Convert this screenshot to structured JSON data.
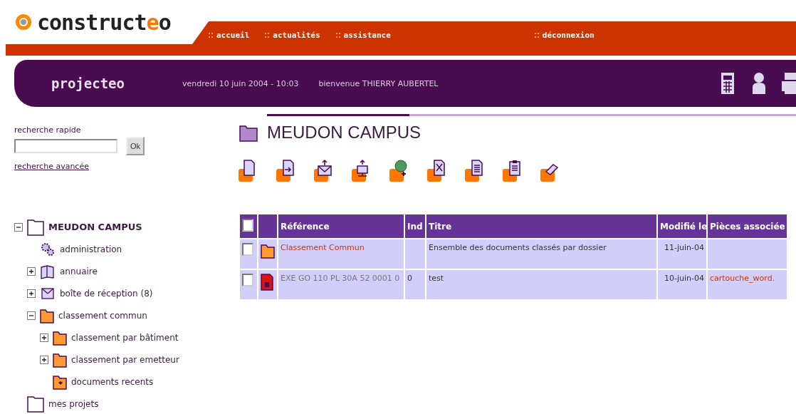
{
  "logo": [
    {
      "text": "construct",
      "accent": false
    },
    {
      "text": "e",
      "accent": true
    },
    {
      "text": "o",
      "accent": false
    }
  ],
  "nav": [
    {
      "label": "accueil"
    },
    {
      "label": "actualités"
    },
    {
      "label": "assistance"
    }
  ],
  "logout": {
    "label": "déconnexion"
  },
  "app_bar": {
    "app_name": "projecteo",
    "date": "vendredi 10 juin 2004 - 10:03",
    "welcome": "bienvenue THIERRY AUBERTEL"
  },
  "search": {
    "label": "recherche rapide",
    "button": "Ok",
    "advanced_link": "recherche avancée"
  },
  "tree": [
    {
      "label": "MEUDON CAMPUS",
      "kind": "root",
      "expanded": true,
      "children": [
        {
          "label": "administration",
          "kind": "admin"
        },
        {
          "label": "annuaire",
          "kind": "directory",
          "expanded": false
        },
        {
          "label": "boîte de réception (8)",
          "kind": "inbox",
          "expanded": false
        },
        {
          "label": "classement commun",
          "kind": "folder",
          "expanded": true,
          "children": [
            {
              "label": "classement par bâtiment",
              "kind": "folder",
              "expanded": false
            },
            {
              "label": "classement par emetteur",
              "kind": "folder",
              "expanded": false
            },
            {
              "label": "documents recents",
              "kind": "recent"
            }
          ]
        }
      ]
    },
    {
      "label": "mes projets",
      "kind": "project"
    }
  ],
  "page_title": "MEUDON CAMPUS",
  "table": {
    "select_all_checked": false,
    "columns": [
      "Référence",
      "Ind",
      "Titre",
      "Modifié le",
      "Pièces associée"
    ],
    "rows": [
      {
        "kind": "folder",
        "checked": false,
        "reference": "Classement Commun",
        "ind": "",
        "title": "Ensemble des documents classés par dossier",
        "modified": "11-juin-04"
      },
      {
        "kind": "document",
        "checked": false,
        "reference": "EXE GO 110 PL 30A 52 0001 0",
        "ind": "0",
        "title": "test",
        "modified": "10-juin-04",
        "attachment": "cartouche_word."
      }
    ]
  }
}
